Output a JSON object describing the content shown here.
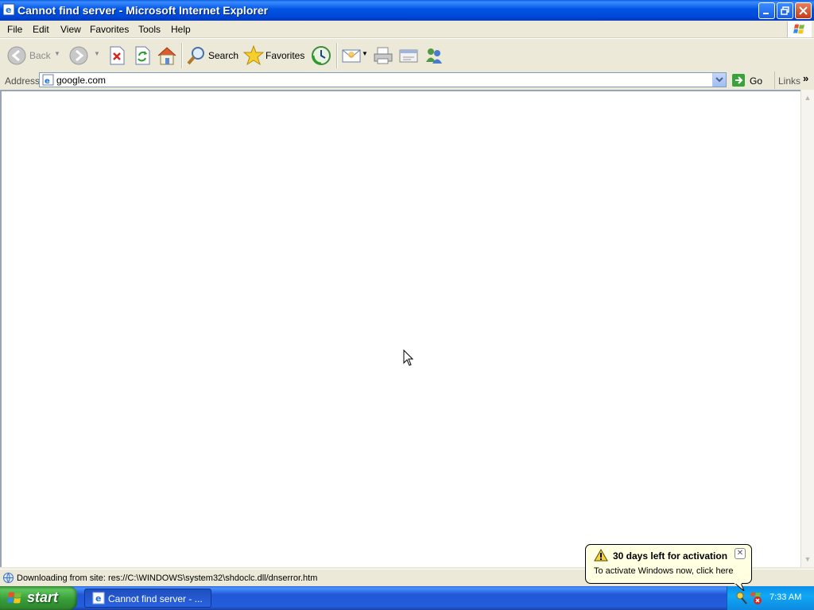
{
  "window": {
    "title": "Cannot find server - Microsoft Internet Explorer"
  },
  "menu": [
    "File",
    "Edit",
    "View",
    "Favorites",
    "Tools",
    "Help"
  ],
  "toolbar": {
    "back_label": "Back",
    "search_label": "Search",
    "favorites_label": "Favorites"
  },
  "address": {
    "label": "Address",
    "value": "google.com",
    "go_label": "Go",
    "links_label": "Links",
    "chevron": "»"
  },
  "status": {
    "text": "Downloading from site: res://C:\\WINDOWS\\system32\\shdoclc.dll/dnserror.htm"
  },
  "taskbar": {
    "start_label": "start",
    "task_label": "Cannot find server - ...",
    "clock": "7:33 AM"
  },
  "balloon": {
    "title": "30 days left for activation",
    "body": "To activate Windows now, click here",
    "close_glyph": "✕"
  },
  "colors": {
    "titlebar": "#0054e3",
    "taskbar": "#245edb",
    "start_green": "#389e38",
    "balloon_bg": "#ffffe1"
  }
}
